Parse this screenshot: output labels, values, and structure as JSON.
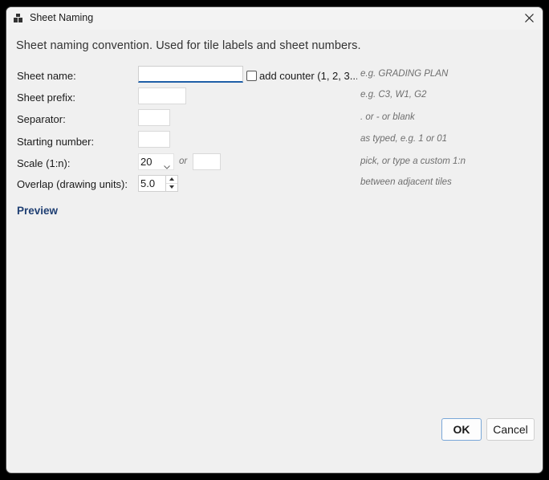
{
  "window": {
    "title": "Sheet Naming"
  },
  "intro": "Sheet naming convention. Used for tile labels and sheet numbers.",
  "fields": {
    "sheet_name": {
      "label": "Sheet name:",
      "value": "",
      "hint": "e.g. GRADING PLAN"
    },
    "counter": {
      "label": "add counter (1, 2, 3...)",
      "checked": false
    },
    "sheet_prefix": {
      "label": "Sheet prefix:",
      "value": "",
      "hint": "e.g. C3, W1, G2"
    },
    "separator": {
      "label": "Separator:",
      "value": "",
      "hint": ". or - or blank"
    },
    "starting_number": {
      "label": "Starting number:",
      "value": "",
      "hint": "as typed, e.g. 1 or 01"
    },
    "scale": {
      "label": "Scale (1:n):",
      "selected": "20",
      "or": "or",
      "custom_value": "",
      "hint": "pick, or type a custom 1:n"
    },
    "overlap": {
      "label": "Overlap (drawing units):",
      "value": "5.0",
      "hint": "between adjacent tiles"
    }
  },
  "preview_label": "Preview",
  "buttons": {
    "ok": "OK",
    "cancel": "Cancel"
  },
  "icons": {
    "app": "app-window-icon",
    "close": "close-icon",
    "dropdown": "chevron-down-icon",
    "spin_up": "spin-up-icon",
    "spin_down": "spin-down-icon"
  },
  "colors": {
    "link": "#1f3f73",
    "focus": "#1f5fa8",
    "ok_border": "#7aa7d8"
  }
}
